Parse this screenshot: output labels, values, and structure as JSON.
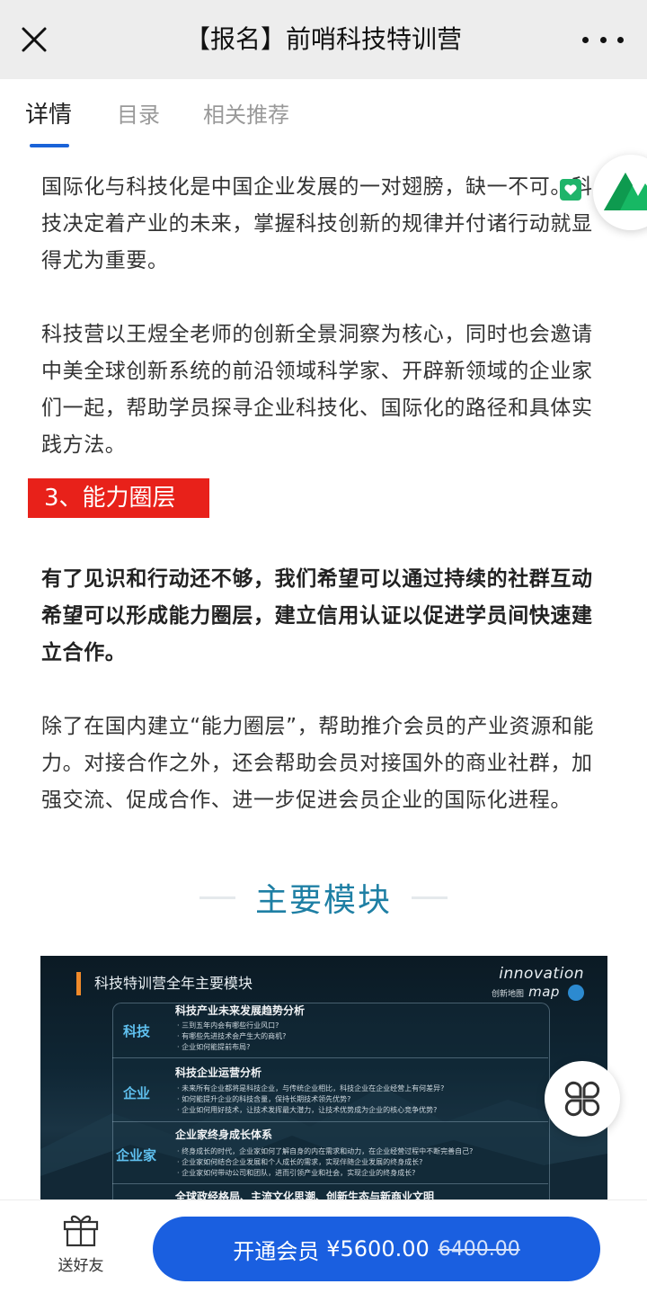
{
  "topbar": {
    "title": "【报名】前哨科技特训营",
    "close_icon": "close-icon",
    "more_icon": "more-dots-icon"
  },
  "tabs": [
    {
      "label": "详情",
      "active": true
    },
    {
      "label": "目录",
      "active": false
    },
    {
      "label": "相关推荐",
      "active": false
    }
  ],
  "content": {
    "para1": "国际化与科技化是中国企业发展的一对翅膀，缺一不可。科技决定着产业的未来，掌握科技创新的规律并付诸行动就显得尤为重要。",
    "para2": "科技营以王煜全老师的创新全景洞察为核心，同时也会邀请中美全球创新系统的前沿领域科学家、开辟新领域的企业家们一起，帮助学员探寻企业科技化、国际化的路径和具体实践方法。",
    "section_tag": "3、能力圈层",
    "para3_bold": "有了见识和行动还不够，我们希望可以通过持续的社群互动希望可以形成能力圈层，建立信用认证以促进学员间快速建立合作。",
    "para4": "除了在国内建立“能力圈层”，帮助推介会员的产业资源和能力。对接合作之外，还会帮助会员对接国外的商业社群，加强交流、促成合作、进一步促进会员企业的国际化进程。",
    "heading": "主要模块"
  },
  "module_image": {
    "title": "科技特训营全年主要模块",
    "logo_line1": "innovation",
    "logo_line2": "创新地图",
    "logo_line3": "map",
    "rows": [
      {
        "category": "科技",
        "head": "科技产业未来发展趋势分析",
        "bullets": [
          "· 三到五年内会有哪些行业风口?",
          "· 有哪些先进技术会产生大的商机?",
          "· 企业如何能提前布局?"
        ]
      },
      {
        "category": "企业",
        "head": "科技企业运营分析",
        "bullets": [
          "· 未来所有企业都将是科技企业，与传统企业相比，科技企业在企业经营上有何差异?",
          "· 如何能提升企业的科技含量，保持长期技术领先优势?",
          "· 企业如何用好技术，让技术发挥最大潜力，让技术优势成为企业的核心竞争优势?"
        ]
      },
      {
        "category": "企业家",
        "head": "企业家终身成长体系",
        "bullets": [
          "· 终身成长的时代，企业家如何了解自身的内在需求和动力，在企业经营过程中不断完善自己?",
          "· 企业家如何结合企业发展和个人成长的需求，实现伴随企业发展的终身成长?",
          "· 企业家如何带动公司和团队，进而引领产业和社会，实现企业的终身成长?"
        ]
      },
      {
        "category": "",
        "head": "全球政经格局、主流文化思潮、创新生态与新商业文明",
        "bullets": []
      }
    ]
  },
  "floating": {
    "logo_icon": "green-mountain-logo-icon",
    "grid_icon": "clover-grid-icon"
  },
  "bottombar": {
    "gift_label": "送好友",
    "gift_icon": "gift-icon",
    "buy_label": "开通会员",
    "price": "¥5600.00",
    "original_price": "6400.00",
    "colors": {
      "button": "#1a5fe0",
      "section_tag": "#e8211a",
      "heading": "#1e7fa4",
      "tab_underline": "#1a63d8"
    }
  }
}
